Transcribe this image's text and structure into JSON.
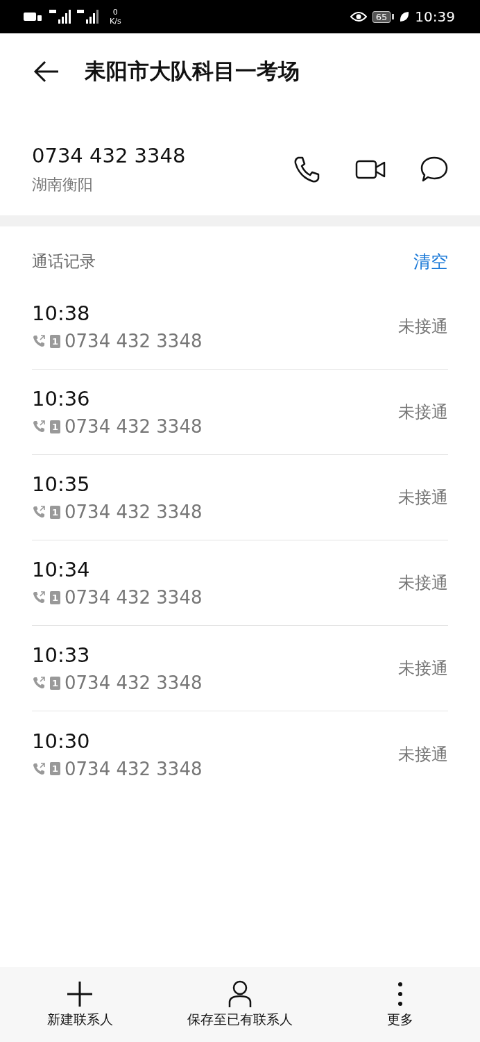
{
  "status_bar": {
    "speed_value": "0",
    "speed_unit": "K/s",
    "battery": "65",
    "time": "10:39"
  },
  "header": {
    "title": "耒阳市大队科目一考场"
  },
  "contact": {
    "number": "0734 432 3348",
    "location": "湖南衡阳"
  },
  "call_log": {
    "title": "通话记录",
    "clear": "清空",
    "entries": [
      {
        "time": "10:38",
        "sim": "1",
        "number": "0734 432 3348",
        "status": "未接通"
      },
      {
        "time": "10:36",
        "sim": "1",
        "number": "0734 432 3348",
        "status": "未接通"
      },
      {
        "time": "10:35",
        "sim": "1",
        "number": "0734 432 3348",
        "status": "未接通"
      },
      {
        "time": "10:34",
        "sim": "1",
        "number": "0734 432 3348",
        "status": "未接通"
      },
      {
        "time": "10:33",
        "sim": "1",
        "number": "0734 432 3348",
        "status": "未接通"
      },
      {
        "time": "10:30",
        "sim": "1",
        "number": "0734 432 3348",
        "status": "未接通"
      }
    ]
  },
  "bottom_bar": [
    {
      "kind": "add",
      "label": "新建联系人"
    },
    {
      "kind": "person",
      "label": "保存至已有联系人"
    },
    {
      "kind": "more",
      "label": "更多"
    }
  ]
}
